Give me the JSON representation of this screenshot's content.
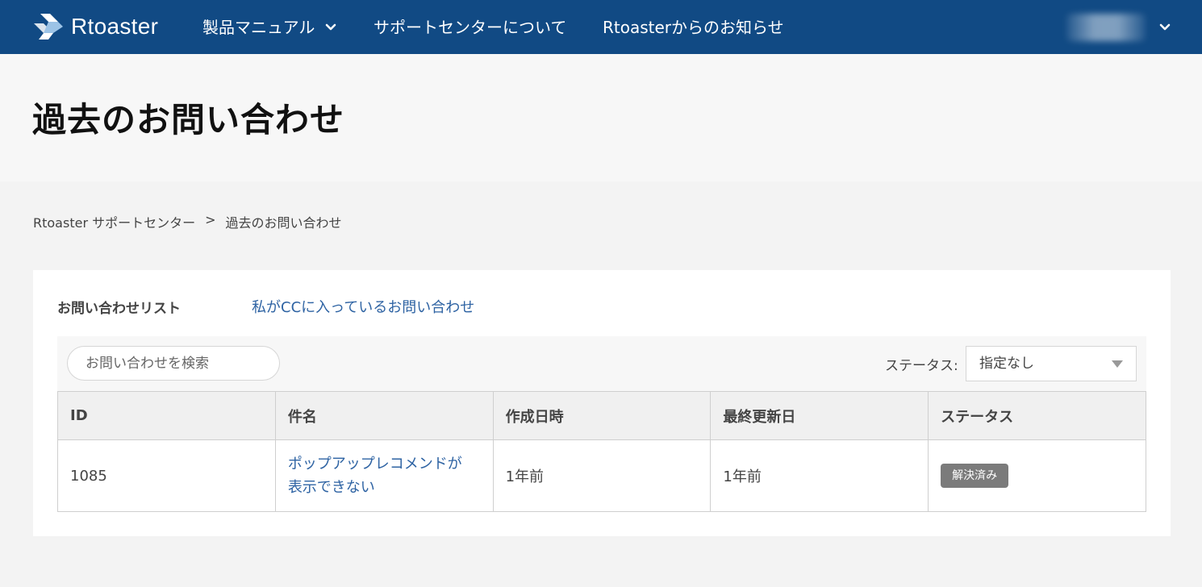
{
  "header": {
    "logo_text": "Rtoaster",
    "nav": [
      {
        "label": "製品マニュアル"
      },
      {
        "label": "サポートセンターについて"
      },
      {
        "label": "Rtoasterからのお知らせ"
      }
    ]
  },
  "page": {
    "title": "過去のお問い合わせ"
  },
  "breadcrumb": {
    "items": [
      "Rtoaster サポートセンター",
      "過去のお問い合わせ"
    ],
    "separator": ">"
  },
  "tabs": {
    "active": "お問い合わせリスト",
    "cc_link": "私がCCに入っているお問い合わせ"
  },
  "search": {
    "placeholder": "お問い合わせを検索",
    "value": ""
  },
  "status_filter": {
    "label": "ステータス:",
    "selected": "指定なし"
  },
  "table": {
    "headers": [
      "ID",
      "件名",
      "作成日時",
      "最終更新日",
      "ステータス"
    ],
    "rows": [
      {
        "id": "1085",
        "subject_line1": "ポップアップレコメンドが",
        "subject_line2": "表示できない",
        "created": "1年前",
        "updated": "1年前",
        "status": "解決済み"
      }
    ]
  },
  "colors": {
    "header_bg": "#114a84",
    "link": "#2e63a3",
    "badge_bg": "#7b7b7b"
  }
}
